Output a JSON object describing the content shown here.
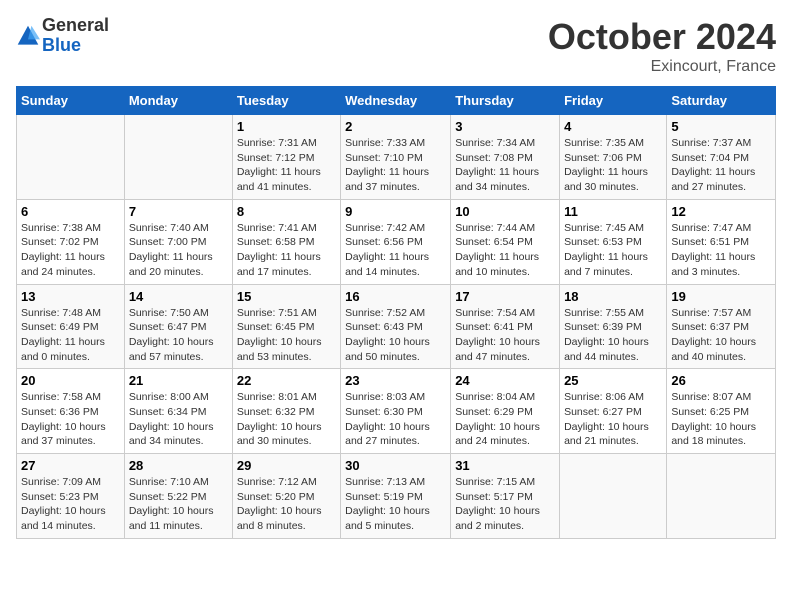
{
  "header": {
    "logo_general": "General",
    "logo_blue": "Blue",
    "month_title": "October 2024",
    "location": "Exincourt, France"
  },
  "days_of_week": [
    "Sunday",
    "Monday",
    "Tuesday",
    "Wednesday",
    "Thursday",
    "Friday",
    "Saturday"
  ],
  "weeks": [
    [
      {
        "day": "",
        "sunrise": "",
        "sunset": "",
        "daylight": ""
      },
      {
        "day": "",
        "sunrise": "",
        "sunset": "",
        "daylight": ""
      },
      {
        "day": "1",
        "sunrise": "Sunrise: 7:31 AM",
        "sunset": "Sunset: 7:12 PM",
        "daylight": "Daylight: 11 hours and 41 minutes."
      },
      {
        "day": "2",
        "sunrise": "Sunrise: 7:33 AM",
        "sunset": "Sunset: 7:10 PM",
        "daylight": "Daylight: 11 hours and 37 minutes."
      },
      {
        "day": "3",
        "sunrise": "Sunrise: 7:34 AM",
        "sunset": "Sunset: 7:08 PM",
        "daylight": "Daylight: 11 hours and 34 minutes."
      },
      {
        "day": "4",
        "sunrise": "Sunrise: 7:35 AM",
        "sunset": "Sunset: 7:06 PM",
        "daylight": "Daylight: 11 hours and 30 minutes."
      },
      {
        "day": "5",
        "sunrise": "Sunrise: 7:37 AM",
        "sunset": "Sunset: 7:04 PM",
        "daylight": "Daylight: 11 hours and 27 minutes."
      }
    ],
    [
      {
        "day": "6",
        "sunrise": "Sunrise: 7:38 AM",
        "sunset": "Sunset: 7:02 PM",
        "daylight": "Daylight: 11 hours and 24 minutes."
      },
      {
        "day": "7",
        "sunrise": "Sunrise: 7:40 AM",
        "sunset": "Sunset: 7:00 PM",
        "daylight": "Daylight: 11 hours and 20 minutes."
      },
      {
        "day": "8",
        "sunrise": "Sunrise: 7:41 AM",
        "sunset": "Sunset: 6:58 PM",
        "daylight": "Daylight: 11 hours and 17 minutes."
      },
      {
        "day": "9",
        "sunrise": "Sunrise: 7:42 AM",
        "sunset": "Sunset: 6:56 PM",
        "daylight": "Daylight: 11 hours and 14 minutes."
      },
      {
        "day": "10",
        "sunrise": "Sunrise: 7:44 AM",
        "sunset": "Sunset: 6:54 PM",
        "daylight": "Daylight: 11 hours and 10 minutes."
      },
      {
        "day": "11",
        "sunrise": "Sunrise: 7:45 AM",
        "sunset": "Sunset: 6:53 PM",
        "daylight": "Daylight: 11 hours and 7 minutes."
      },
      {
        "day": "12",
        "sunrise": "Sunrise: 7:47 AM",
        "sunset": "Sunset: 6:51 PM",
        "daylight": "Daylight: 11 hours and 3 minutes."
      }
    ],
    [
      {
        "day": "13",
        "sunrise": "Sunrise: 7:48 AM",
        "sunset": "Sunset: 6:49 PM",
        "daylight": "Daylight: 11 hours and 0 minutes."
      },
      {
        "day": "14",
        "sunrise": "Sunrise: 7:50 AM",
        "sunset": "Sunset: 6:47 PM",
        "daylight": "Daylight: 10 hours and 57 minutes."
      },
      {
        "day": "15",
        "sunrise": "Sunrise: 7:51 AM",
        "sunset": "Sunset: 6:45 PM",
        "daylight": "Daylight: 10 hours and 53 minutes."
      },
      {
        "day": "16",
        "sunrise": "Sunrise: 7:52 AM",
        "sunset": "Sunset: 6:43 PM",
        "daylight": "Daylight: 10 hours and 50 minutes."
      },
      {
        "day": "17",
        "sunrise": "Sunrise: 7:54 AM",
        "sunset": "Sunset: 6:41 PM",
        "daylight": "Daylight: 10 hours and 47 minutes."
      },
      {
        "day": "18",
        "sunrise": "Sunrise: 7:55 AM",
        "sunset": "Sunset: 6:39 PM",
        "daylight": "Daylight: 10 hours and 44 minutes."
      },
      {
        "day": "19",
        "sunrise": "Sunrise: 7:57 AM",
        "sunset": "Sunset: 6:37 PM",
        "daylight": "Daylight: 10 hours and 40 minutes."
      }
    ],
    [
      {
        "day": "20",
        "sunrise": "Sunrise: 7:58 AM",
        "sunset": "Sunset: 6:36 PM",
        "daylight": "Daylight: 10 hours and 37 minutes."
      },
      {
        "day": "21",
        "sunrise": "Sunrise: 8:00 AM",
        "sunset": "Sunset: 6:34 PM",
        "daylight": "Daylight: 10 hours and 34 minutes."
      },
      {
        "day": "22",
        "sunrise": "Sunrise: 8:01 AM",
        "sunset": "Sunset: 6:32 PM",
        "daylight": "Daylight: 10 hours and 30 minutes."
      },
      {
        "day": "23",
        "sunrise": "Sunrise: 8:03 AM",
        "sunset": "Sunset: 6:30 PM",
        "daylight": "Daylight: 10 hours and 27 minutes."
      },
      {
        "day": "24",
        "sunrise": "Sunrise: 8:04 AM",
        "sunset": "Sunset: 6:29 PM",
        "daylight": "Daylight: 10 hours and 24 minutes."
      },
      {
        "day": "25",
        "sunrise": "Sunrise: 8:06 AM",
        "sunset": "Sunset: 6:27 PM",
        "daylight": "Daylight: 10 hours and 21 minutes."
      },
      {
        "day": "26",
        "sunrise": "Sunrise: 8:07 AM",
        "sunset": "Sunset: 6:25 PM",
        "daylight": "Daylight: 10 hours and 18 minutes."
      }
    ],
    [
      {
        "day": "27",
        "sunrise": "Sunrise: 7:09 AM",
        "sunset": "Sunset: 5:23 PM",
        "daylight": "Daylight: 10 hours and 14 minutes."
      },
      {
        "day": "28",
        "sunrise": "Sunrise: 7:10 AM",
        "sunset": "Sunset: 5:22 PM",
        "daylight": "Daylight: 10 hours and 11 minutes."
      },
      {
        "day": "29",
        "sunrise": "Sunrise: 7:12 AM",
        "sunset": "Sunset: 5:20 PM",
        "daylight": "Daylight: 10 hours and 8 minutes."
      },
      {
        "day": "30",
        "sunrise": "Sunrise: 7:13 AM",
        "sunset": "Sunset: 5:19 PM",
        "daylight": "Daylight: 10 hours and 5 minutes."
      },
      {
        "day": "31",
        "sunrise": "Sunrise: 7:15 AM",
        "sunset": "Sunset: 5:17 PM",
        "daylight": "Daylight: 10 hours and 2 minutes."
      },
      {
        "day": "",
        "sunrise": "",
        "sunset": "",
        "daylight": ""
      },
      {
        "day": "",
        "sunrise": "",
        "sunset": "",
        "daylight": ""
      }
    ]
  ]
}
